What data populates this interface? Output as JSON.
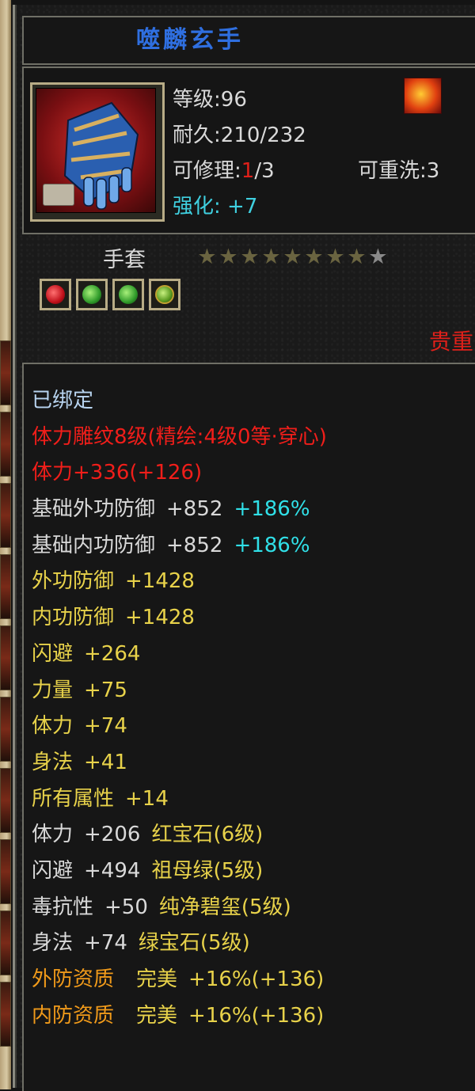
{
  "item": {
    "name": "噬麟玄手",
    "icon": "gauntlet-icon",
    "corner_icon": "flame-icon"
  },
  "stats": {
    "level_label": "等级",
    "level_value": ":96",
    "durability_label": "耐久",
    "durability_value": ":210/232",
    "repair_label": "可修理",
    "repair_colon": ":",
    "repair_used": "1",
    "repair_total": "/3",
    "rewash_label": "可重洗",
    "rewash_value": ":3",
    "enhance_label": "强化:",
    "enhance_value": "+7"
  },
  "type_label": "手套",
  "stars": {
    "filled": 8,
    "total": 9
  },
  "gems": [
    "red-gem-icon",
    "green-gem-icon",
    "green-gem-icon",
    "jade-gem-icon"
  ],
  "precious_label": "贵重",
  "attributes": {
    "bound": "已绑定",
    "engrave": "体力雕纹8级(精绘:4级0等·穿心)",
    "engrave_stat": "体力+336(+126)",
    "base_ext_def_label": "基础外功防御",
    "base_ext_def_value": "+852",
    "base_ext_def_pct": "+186%",
    "base_int_def_label": "基础内功防御",
    "base_int_def_value": "+852",
    "base_int_def_pct": "+186%",
    "ext_def_label": "外功防御",
    "ext_def_value": "+1428",
    "int_def_label": "内功防御",
    "int_def_value": "+1428",
    "dodge_label": "闪避",
    "dodge_value": "+264",
    "strength_label": "力量",
    "strength_value": "+75",
    "vitality_label": "体力",
    "vitality_value": "+74",
    "agility_label": "身法",
    "agility_value": "+41",
    "all_attr_label": "所有属性",
    "all_attr_value": "+14",
    "gem1_label": "体力",
    "gem1_value": "+206",
    "gem1_name": "红宝石(6级)",
    "gem2_label": "闪避",
    "gem2_value": "+494",
    "gem2_name": "祖母绿(5级)",
    "gem3_label": "毒抗性",
    "gem3_value": "+50",
    "gem3_name": "纯净碧玺(5级)",
    "gem4_label": "身法",
    "gem4_value": "+74",
    "gem4_name": "绿宝石(5级)",
    "ext_quality_label": "外防资质",
    "ext_quality_grade": "完美",
    "ext_quality_value": "+16%(+136)",
    "int_quality_label": "内防资质",
    "int_quality_grade": "完美",
    "int_quality_value": "+16%(+136)"
  },
  "colors": {
    "title": "#2f6fe0",
    "red": "#f01e1a",
    "yellow": "#e8d24a",
    "orange": "#f09a1a",
    "cyan": "#30e0e8"
  }
}
